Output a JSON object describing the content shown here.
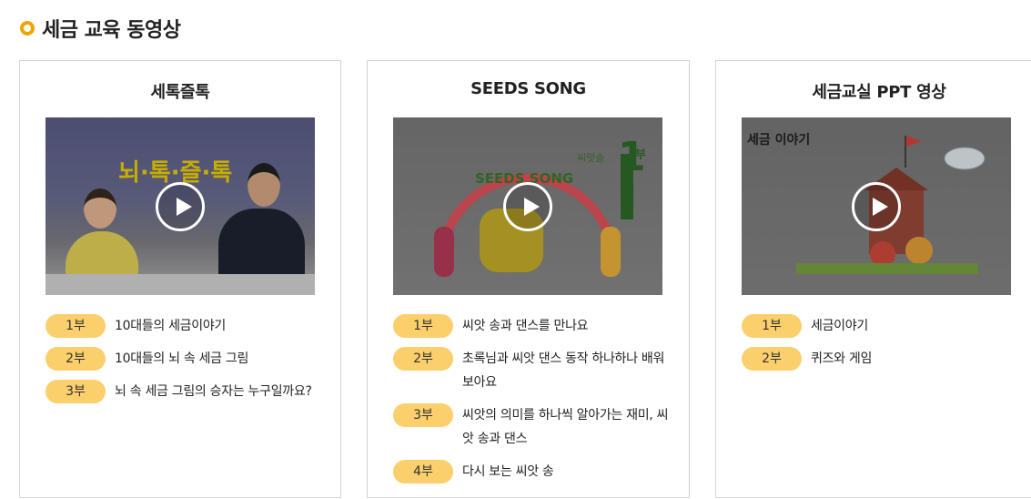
{
  "section": {
    "title": "세금 교육 동영상"
  },
  "cards": [
    {
      "title": "세톡즐톡",
      "thumbnail_text": "뇌·톡·즐·톡",
      "episodes": [
        {
          "badge": "1부",
          "text": "10대들의 세금이야기"
        },
        {
          "badge": "2부",
          "text": "10대들의 뇌 속 세금 그림"
        },
        {
          "badge": "3부",
          "text": "뇌 속 세금 그림의 승자는 누구일까요?"
        }
      ]
    },
    {
      "title": "SEEDS SONG",
      "thumbnail_text": "SEEDS SONG",
      "thumbnail_sub": "씨앗송",
      "thumbnail_num": "1",
      "thumbnail_suffix": "부",
      "episodes": [
        {
          "badge": "1부",
          "text": "씨앗 송과 댄스를 만나요"
        },
        {
          "badge": "2부",
          "text": "초록님과 씨앗 댄스 동작 하나하나 배워보아요"
        },
        {
          "badge": "3부",
          "text": "씨앗의 의미를 하나씩 알아가는 재미, 씨앗 송과 댄스"
        },
        {
          "badge": "4부",
          "text": "다시 보는 씨앗 송"
        }
      ]
    },
    {
      "title": "세금교실 PPT 영상",
      "thumbnail_text": "세금 이야기",
      "episodes": [
        {
          "badge": "1부",
          "text": "세금이야기"
        },
        {
          "badge": "2부",
          "text": "퀴즈와 게임"
        }
      ]
    }
  ]
}
